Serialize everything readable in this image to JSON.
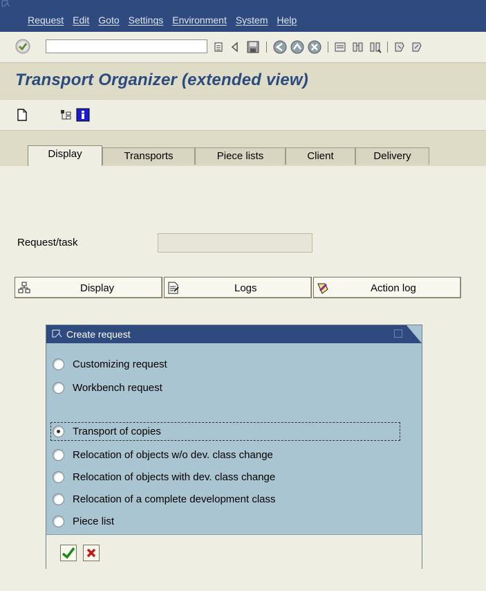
{
  "menubar": {
    "items": [
      {
        "label": "Request"
      },
      {
        "label": "Edit"
      },
      {
        "label": "Goto"
      },
      {
        "label": "Settings"
      },
      {
        "label": "Environment"
      },
      {
        "label": "System"
      },
      {
        "label": "Help"
      }
    ]
  },
  "toolbar": {
    "command_value": "",
    "icons": [
      "enter-icon",
      "save-icon",
      "back-icon",
      "exit-icon",
      "cancel-icon",
      "print-icon",
      "find-icon",
      "find-next-icon",
      "first-page-icon",
      "previous-page-icon"
    ]
  },
  "page": {
    "title": "Transport Organizer (extended view)"
  },
  "tabs": [
    {
      "label": "Display",
      "active": true
    },
    {
      "label": "Transports",
      "active": false
    },
    {
      "label": "Piece lists",
      "active": false
    },
    {
      "label": "Client",
      "active": false
    },
    {
      "label": "Delivery",
      "active": false
    }
  ],
  "form": {
    "request_label": "Request/task",
    "request_value": ""
  },
  "buttons": {
    "display": "Display",
    "logs": "Logs",
    "action_log": "Action log"
  },
  "dialog": {
    "title": "Create request",
    "options": [
      {
        "label": "Customizing request",
        "selected": false
      },
      {
        "label": "Workbench request",
        "selected": false
      },
      {
        "label": "Transport of copies",
        "selected": true
      },
      {
        "label": "Relocation of objects w/o dev. class change",
        "selected": false
      },
      {
        "label": "Relocation of objects with dev. class change",
        "selected": false
      },
      {
        "label": "Relocation of a complete development class",
        "selected": false
      },
      {
        "label": "Piece list",
        "selected": false
      }
    ]
  },
  "colors": {
    "menubar": "#2f4a7e",
    "title": "#2b4a7e",
    "dialog_body": "#a9c5d2",
    "background": "#efeee2"
  }
}
